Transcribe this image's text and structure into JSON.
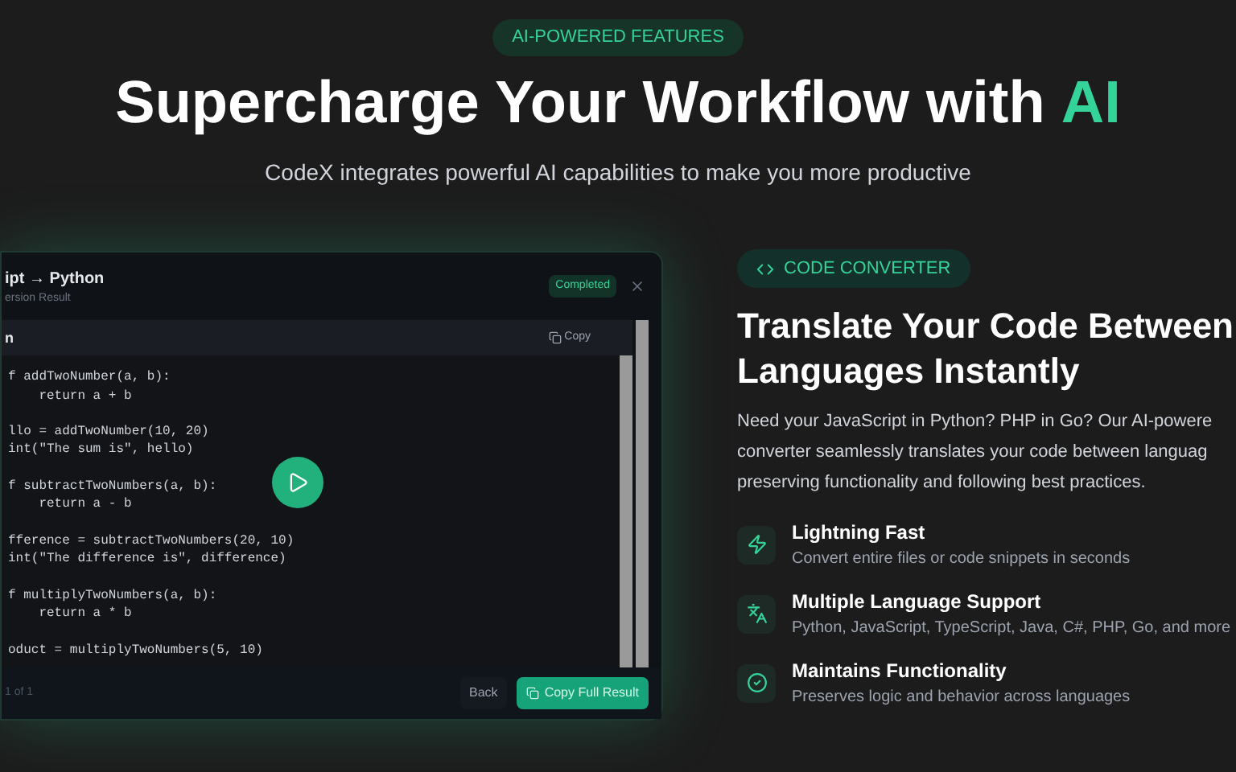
{
  "hero": {
    "badge": "AI-POWERED FEATURES",
    "title": "Supercharge Your Workflow with",
    "title_highlight": "AI",
    "subtitle": "CodeX integrates powerful AI capabilities to make you more productive"
  },
  "preview": {
    "title": "ipt → Python",
    "subtitle": "ersion Result",
    "status": "Completed",
    "panel_label": "n",
    "copy": "Copy",
    "code_blocks": [
      [
        "f addTwoNumber(a, b):",
        "    return a + b"
      ],
      [
        "llo = addTwoNumber(10, 20)",
        "int(\"The sum is\", hello)"
      ],
      [
        "f subtractTwoNumbers(a, b):",
        "    return a - b"
      ],
      [
        "fference = subtractTwoNumbers(20, 10)",
        "int(\"The difference is\", difference)"
      ],
      [
        "f multiplyTwoNumbers(a, b):",
        "    return a * b"
      ],
      [
        "oduct = multiplyTwoNumbers(5, 10)"
      ]
    ],
    "footer": "1 of 1",
    "buttons": [
      {
        "label": "Back",
        "kind": "secondary"
      },
      {
        "label": "Copy Full Result",
        "kind": "primary"
      }
    ]
  },
  "feature": {
    "badge": "CODE CONVERTER",
    "title": "Translate Your Code Between Languages Instantly",
    "description_lines": [
      "Need your JavaScript in Python? PHP in Go? Our AI-powere",
      "converter seamlessly translates your code between languag",
      "preserving functionality and following best practices."
    ],
    "items": [
      {
        "kind": "speed",
        "title": "Lightning Fast",
        "text": "Convert entire files or code snippets in seconds"
      },
      {
        "kind": "languages",
        "title": "Multiple Language Support",
        "text": "Python, JavaScript, TypeScript, Java, C#, PHP, Go, and more"
      },
      {
        "kind": "check",
        "title": "Maintains Functionality",
        "text": "Preserves logic and behavior across languages"
      }
    ]
  }
}
